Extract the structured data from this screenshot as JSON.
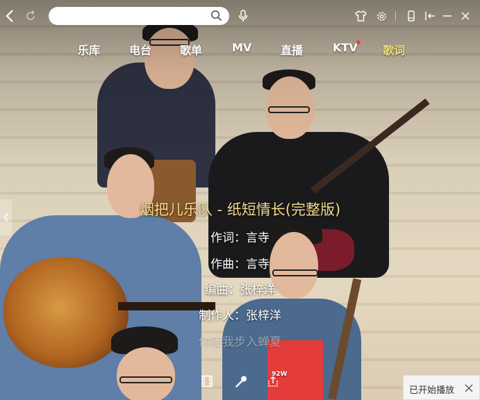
{
  "search": {
    "value": "",
    "placeholder": ""
  },
  "nav": {
    "items": [
      {
        "label": "乐库"
      },
      {
        "label": "电台"
      },
      {
        "label": "歌单"
      },
      {
        "label": "MV"
      },
      {
        "label": "直播"
      },
      {
        "label": "KTV"
      },
      {
        "label": "歌词"
      }
    ],
    "active": "歌词"
  },
  "lyrics": {
    "title": "烟把儿乐队 - 纸短情长(完整版)",
    "lines": [
      "作词：言寺",
      "作曲：言寺",
      "编曲：张梓洋",
      "制作人：张梓洋",
      "你陪我步入蝉夏"
    ]
  },
  "bottom": {
    "count_badge": "92W"
  },
  "toast": {
    "text": "已开始播放"
  },
  "colors": {
    "active_nav": "#f3de7a",
    "title_lyric": "#f3d98a",
    "notify_dot": "#ff3b3b"
  }
}
